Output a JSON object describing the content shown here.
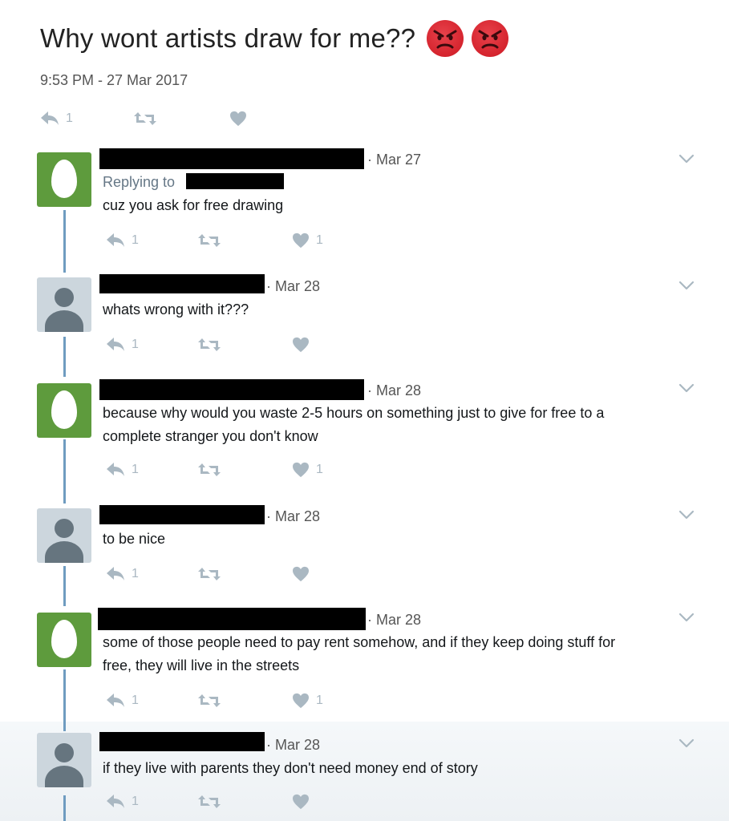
{
  "tweet": {
    "text": "Why wont artists draw for me??",
    "emoji": [
      "angry-face",
      "angry-face"
    ],
    "timestamp": "9:53 PM - 27 Mar 2017",
    "reply_count": "1"
  },
  "replies": [
    {
      "date": "· Mar 27",
      "replying_label": "Replying to",
      "text": "cuz you ask for free drawing",
      "reply_count": "1",
      "like_count": "1"
    },
    {
      "date": "· Mar 28",
      "text": "whats wrong with it???",
      "reply_count": "1",
      "like_count": ""
    },
    {
      "date": "· Mar 28",
      "text_lines": [
        "because why would you waste 2-5 hours on something just to give for free to a",
        "complete stranger you don't know"
      ],
      "reply_count": "1",
      "like_count": "1"
    },
    {
      "date": "· Mar 28",
      "text": "to be nice",
      "reply_count": "1",
      "like_count": ""
    },
    {
      "date": "· Mar 28",
      "text_lines": [
        "some of those people need to pay rent somehow, and if they keep doing stuff for",
        "free, they will live in the streets"
      ],
      "reply_count": "1",
      "like_count": "1"
    },
    {
      "date": "· Mar 28",
      "text": "if they live with parents they don't need money end of story",
      "reply_count": "1",
      "like_count": ""
    }
  ],
  "colors": {
    "icon_gray": "#aab8c2",
    "egg_green": "#5e9b3d",
    "thread_blue": "#6f9cc0",
    "emoji_red": "#d5242e"
  }
}
